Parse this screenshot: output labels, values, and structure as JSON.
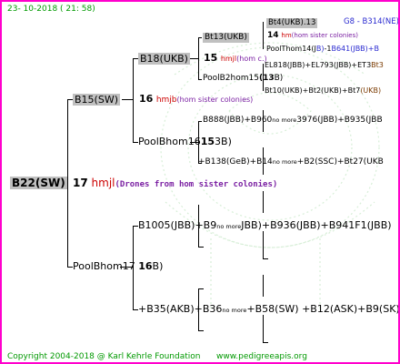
{
  "header": {
    "date": "23- 10-2018 ( 21: 58)"
  },
  "root": {
    "name": "B22(SW)",
    "num": "17",
    "queen_tag": "hmjl",
    "note": "(Drones from hom sister colonies)"
  },
  "gen1": {
    "top": {
      "name": "B15(SW)",
      "num": "16",
      "tag": "hmjb",
      "note": "(hom sister colonies)"
    },
    "bottom": {
      "name_a": "PoolBhom17",
      "name_b": "16",
      "name_c": "B)"
    }
  },
  "gen2": {
    "b18": {
      "name": "B18(UKB)",
      "num": "15",
      "tag": "hmjl",
      "note": "(hom c.)"
    },
    "poolb16": {
      "name_a": "PoolBhom16",
      "name_b": "15",
      "name_c": "3B)"
    },
    "b1005": {
      "text_a": "B1005(JBB)+B9",
      "text_more": "no more",
      "text_b": "JBB)+B936(JBB)+B941F1(JBB)"
    },
    "b35": {
      "text_a": "+B35(AKB)+B36",
      "text_more": "no more",
      "text_b": "+B58(SW) +B12(ASK)+B9(SK)+"
    }
  },
  "gen3": {
    "bt13": "Bt13(UKB)",
    "poolb2": {
      "name_a": "PoolB2hom15",
      "name_b": "(13",
      "name_c": "B)"
    },
    "b888": {
      "text_a": "B888(JBB)+B960",
      "text_more": "no more",
      "text_b": "3976(JBB)+B935(JBB"
    },
    "b138": {
      "text_a": "+B138(GeB)+B14",
      "text_more": "no more",
      "text_b": "+B2(SSC)+Bt27(UKB"
    }
  },
  "gen4": {
    "bt4": "Bt4(UKB).13",
    "bt4_right": "G8 - B314(NE)",
    "num14": "14",
    "tag14": "hm",
    "note14": "(hom sister colonies)",
    "pool14": "PoolThom14(J",
    "pool14_b": "B)",
    "pool14_c": "-1",
    "pool14_d": "B641(JBB)+B",
    "el818": "EL818(JBB)+EL793(JBB)+ET3",
    "el818_r": "Bt3",
    "bt10": "Bt10(UKB)+Bt2(UKB)+Bt7",
    "bt10_r": "(UKB)"
  },
  "footer": {
    "copyright": "Copyright 2004-2018 @ Karl Kehrle Foundation",
    "url": "www.pedigreeapis.org"
  },
  "colors": {
    "border": "#ff00cc",
    "footer_text": "#009900",
    "queen_tag": "#cc0000",
    "note": "#7a1fa2",
    "box": "#c0c0c0"
  }
}
